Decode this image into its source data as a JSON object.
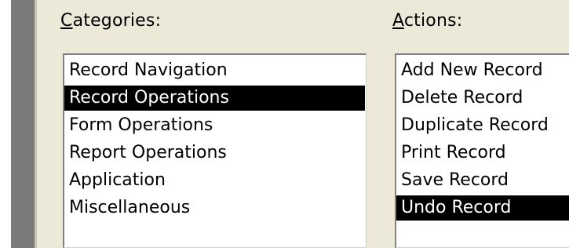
{
  "categories": {
    "label_accel": "C",
    "label_rest": "ategories:",
    "items": [
      {
        "label": "Record Navigation",
        "selected": false
      },
      {
        "label": "Record Operations",
        "selected": true
      },
      {
        "label": "Form Operations",
        "selected": false
      },
      {
        "label": "Report Operations",
        "selected": false
      },
      {
        "label": "Application",
        "selected": false
      },
      {
        "label": "Miscellaneous",
        "selected": false
      }
    ]
  },
  "actions": {
    "label_accel": "A",
    "label_rest": "ctions:",
    "items": [
      {
        "label": "Add New Record",
        "selected": false
      },
      {
        "label": "Delete Record",
        "selected": false
      },
      {
        "label": "Duplicate Record",
        "selected": false
      },
      {
        "label": "Print Record",
        "selected": false
      },
      {
        "label": "Save Record",
        "selected": false
      },
      {
        "label": "Undo Record",
        "selected": true
      }
    ]
  },
  "colors": {
    "selection_bg": "#000000",
    "selection_fg": "#ffffff",
    "dialog_bg": "#ece9d8"
  }
}
